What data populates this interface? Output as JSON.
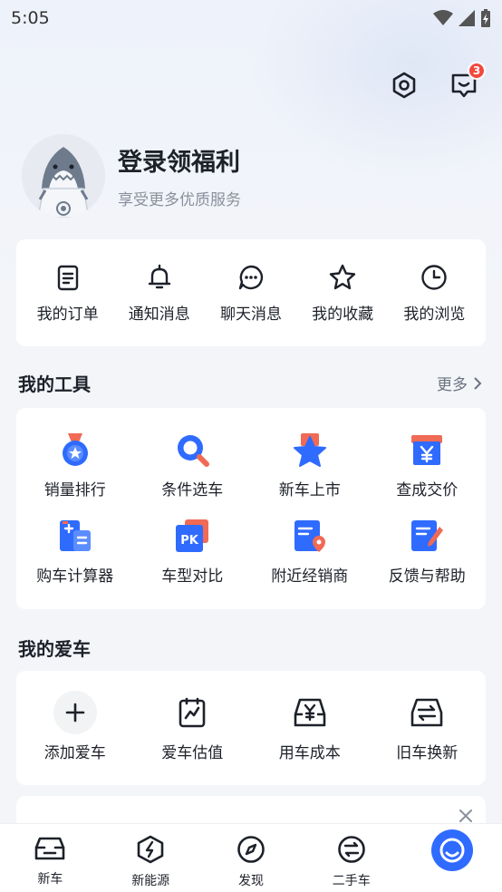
{
  "status": {
    "time": "5:05"
  },
  "header": {
    "message_badge": "3"
  },
  "profile": {
    "title": "登录领福利",
    "subtitle": "享受更多优质服务"
  },
  "quick_actions": [
    {
      "label": "我的订单",
      "icon": "order-list-icon"
    },
    {
      "label": "通知消息",
      "icon": "bell-icon"
    },
    {
      "label": "聊天消息",
      "icon": "chat-bubble-icon"
    },
    {
      "label": "我的收藏",
      "icon": "star-icon"
    },
    {
      "label": "我的浏览",
      "icon": "clock-icon"
    }
  ],
  "tools": {
    "title": "我的工具",
    "more": "更多",
    "items": [
      {
        "label": "销量排行",
        "icon": "medal-icon"
      },
      {
        "label": "条件选车",
        "icon": "search-icon"
      },
      {
        "label": "新车上市",
        "icon": "new-car-star-icon"
      },
      {
        "label": "查成交价",
        "icon": "price-yen-icon"
      },
      {
        "label": "购车计算器",
        "icon": "calculator-icon"
      },
      {
        "label": "车型对比",
        "icon": "pk-compare-icon"
      },
      {
        "label": "附近经销商",
        "icon": "dealer-location-icon"
      },
      {
        "label": "反馈与帮助",
        "icon": "feedback-icon"
      }
    ]
  },
  "my_cars": {
    "title": "我的爱车",
    "items": [
      {
        "label": "添加爱车",
        "icon": "plus-icon"
      },
      {
        "label": "爱车估值",
        "icon": "valuation-chart-icon"
      },
      {
        "label": "用车成本",
        "icon": "car-cost-yen-icon"
      },
      {
        "label": "旧车换新",
        "icon": "car-trade-in-icon"
      }
    ]
  },
  "tabbar": [
    {
      "label": "新车",
      "icon": "car-icon"
    },
    {
      "label": "新能源",
      "icon": "lightning-hex-icon"
    },
    {
      "label": "发现",
      "icon": "compass-icon"
    },
    {
      "label": "二手车",
      "icon": "exchange-icon"
    },
    {
      "label": "",
      "icon": "profile-active-icon"
    }
  ],
  "colors": {
    "accent": "#2f6bff",
    "badge": "#f04a3d",
    "text": "#1d2129"
  }
}
